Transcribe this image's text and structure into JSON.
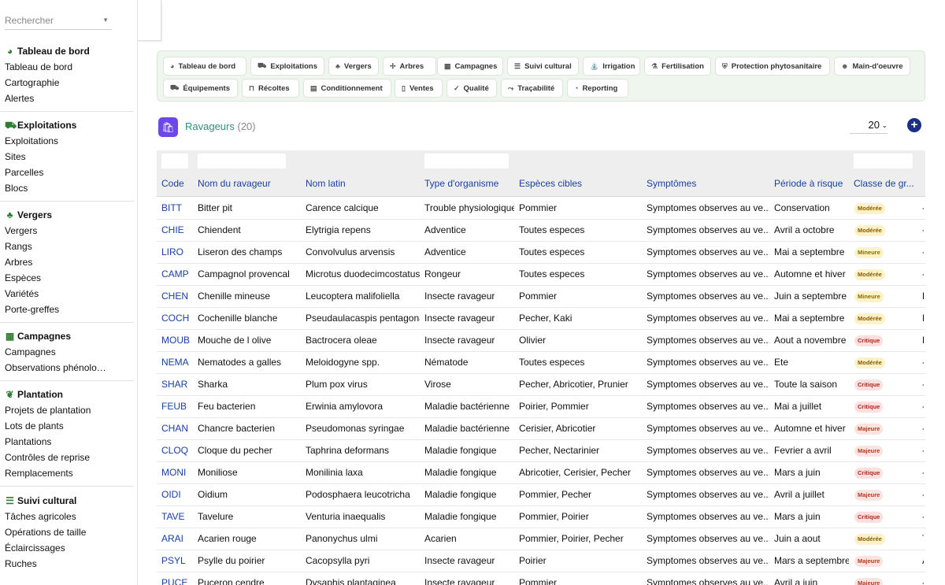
{
  "search": {
    "placeholder": "Rechercher"
  },
  "sidebar": {
    "groups": [
      {
        "title": "Tableau de bord",
        "icon": "dashboard-icon",
        "items": [
          "Tableau de bord",
          "Cartographie",
          "Alertes"
        ]
      },
      {
        "title": "Exploitations",
        "icon": "tractor-icon",
        "items": [
          "Exploitations",
          "Sites",
          "Parcelles",
          "Blocs"
        ]
      },
      {
        "title": "Vergers",
        "icon": "tree-icon",
        "items": [
          "Vergers",
          "Rangs",
          "Arbres",
          "Espèces",
          "Variétés",
          "Porte-greffes"
        ]
      },
      {
        "title": "Campagnes",
        "icon": "calendar-icon",
        "items": [
          "Campagnes",
          "Observations phénologiq..."
        ]
      },
      {
        "title": "Plantation",
        "icon": "seedling-icon",
        "items": [
          "Projets de plantation",
          "Lots de plants",
          "Plantations",
          "Contrôles de reprise",
          "Remplacements"
        ]
      },
      {
        "title": "Suivi cultural",
        "icon": "list-check-icon",
        "items": [
          "Tâches agricoles",
          "Opérations de taille",
          "Éclaircissages",
          "Ruches"
        ]
      }
    ]
  },
  "modules": [
    {
      "label": "Tableau de bord",
      "icon": "dashboard-icon"
    },
    {
      "label": "Exploitations",
      "icon": "tractor-icon"
    },
    {
      "label": "Vergers",
      "icon": "tree-icon"
    },
    {
      "label": "Arbres",
      "icon": "branch-icon"
    },
    {
      "label": "Campagnes",
      "icon": "calendar-icon"
    },
    {
      "label": "Suivi cultural",
      "icon": "list-check-icon"
    },
    {
      "label": "Irrigation",
      "icon": "faucet-icon"
    },
    {
      "label": "Fertilisation",
      "icon": "flask-icon"
    },
    {
      "label": "Protection phytosanitaire",
      "icon": "shield-icon"
    },
    {
      "label": "Main-d'oeuvre",
      "icon": "people-icon"
    },
    {
      "label": "Équipements",
      "icon": "tractor-icon"
    },
    {
      "label": "Récoltes",
      "icon": "basket-icon"
    },
    {
      "label": "Conditionnement",
      "icon": "boxes-icon"
    },
    {
      "label": "Ventes",
      "icon": "invoice-icon"
    },
    {
      "label": "Qualité",
      "icon": "check-icon"
    },
    {
      "label": "Traçabilité",
      "icon": "route-icon"
    },
    {
      "label": "Reporting",
      "icon": "chart-pie-icon"
    }
  ],
  "entity": {
    "title": "Ravageurs",
    "count": "(20)",
    "icon": "bag-icon"
  },
  "page_size": "20",
  "colors": {
    "accent": "#2f8f77",
    "link": "#1a3fa0",
    "entity_icon": "#6d48e8",
    "add_button": "#1a2e8a"
  },
  "table": {
    "columns": [
      "Code",
      "Nom du ravageur",
      "Nom latin",
      "Type d'organisme",
      "Espèces cibles",
      "Symptômes",
      "Période à risque",
      "Classe de gr...",
      "A"
    ],
    "rows": [
      {
        "code": "BITT",
        "nom": "Bitter pit",
        "latin": "Carence calcique",
        "type": "Trouble physiologique",
        "especes": "Pommier",
        "symptomes": "Symptomes observes au ve...",
        "periode": "Conservation",
        "classe": "Modérée",
        "last": "-"
      },
      {
        "code": "CHIE",
        "nom": "Chiendent",
        "latin": "Elytrigia repens",
        "type": "Adventice",
        "especes": "Toutes especes",
        "symptomes": "Symptomes observes au ve...",
        "periode": "Avril a octobre",
        "classe": "Modérée",
        "last": "-"
      },
      {
        "code": "LIRO",
        "nom": "Liseron des champs",
        "latin": "Convolvulus arvensis",
        "type": "Adventice",
        "especes": "Toutes especes",
        "symptomes": "Symptomes observes au ve...",
        "periode": "Mai a septembre",
        "classe": "Mineure",
        "last": "-"
      },
      {
        "code": "CAMP",
        "nom": "Campagnol provencal",
        "latin": "Microtus duodecimcostatus",
        "type": "Rongeur",
        "especes": "Toutes especes",
        "symptomes": "Symptomes observes au ve...",
        "periode": "Automne et hiver",
        "classe": "Modérée",
        "last": "-"
      },
      {
        "code": "CHEN",
        "nom": "Chenille mineuse",
        "latin": "Leucoptera malifoliella",
        "type": "Insecte ravageur",
        "especes": "Pommier",
        "symptomes": "Symptomes observes au ve...",
        "periode": "Juin a septembre",
        "classe": "Mineure",
        "last": "F"
      },
      {
        "code": "COCH",
        "nom": "Cochenille blanche",
        "latin": "Pseudaulacaspis pentagona",
        "type": "Insecte ravageur",
        "especes": "Pecher, Kaki",
        "symptomes": "Symptomes observes au ve...",
        "periode": "Mai a septembre",
        "classe": "Modérée",
        "last": "E"
      },
      {
        "code": "MOUB",
        "nom": "Mouche de l olive",
        "latin": "Bactrocera oleae",
        "type": "Insecte ravageur",
        "especes": "Olivier",
        "symptomes": "Symptomes observes au ve...",
        "periode": "Aout a novembre",
        "classe": "Critique",
        "last": "F"
      },
      {
        "code": "NEMA",
        "nom": "Nematodes a galles",
        "latin": "Meloidogyne spp.",
        "type": "Nématode",
        "especes": "Toutes especes",
        "symptomes": "Symptomes observes au ve...",
        "periode": "Ete",
        "classe": "Modérée",
        "last": "-"
      },
      {
        "code": "SHAR",
        "nom": "Sharka",
        "latin": "Plum pox virus",
        "type": "Virose",
        "especes": "Pecher, Abricotier, Prunier",
        "symptomes": "Symptomes observes au ve...",
        "periode": "Toute la saison",
        "classe": "Critique",
        "last": "-"
      },
      {
        "code": "FEUB",
        "nom": "Feu bacterien",
        "latin": "Erwinia amylovora",
        "type": "Maladie bactérienne",
        "especes": "Poirier, Pommier",
        "symptomes": "Symptomes observes au ve...",
        "periode": "Mai a juillet",
        "classe": "Critique",
        "last": "-"
      },
      {
        "code": "CHAN",
        "nom": "Chancre bacterien",
        "latin": "Pseudomonas syringae",
        "type": "Maladie bactérienne",
        "especes": "Cerisier, Abricotier",
        "symptomes": "Symptomes observes au ve...",
        "periode": "Automne et hiver",
        "classe": "Majeure",
        "last": "-"
      },
      {
        "code": "CLOQ",
        "nom": "Cloque du pecher",
        "latin": "Taphrina deformans",
        "type": "Maladie fongique",
        "especes": "Pecher, Nectarinier",
        "symptomes": "Symptomes observes au ve...",
        "periode": "Fevrier a avril",
        "classe": "Majeure",
        "last": "-"
      },
      {
        "code": "MONI",
        "nom": "Moniliose",
        "latin": "Monilinia laxa",
        "type": "Maladie fongique",
        "especes": "Abricotier, Cerisier, Pecher",
        "symptomes": "Symptomes observes au ve...",
        "periode": "Mars a juin",
        "classe": "Critique",
        "last": "-"
      },
      {
        "code": "OIDI",
        "nom": "Oidium",
        "latin": "Podosphaera leucotricha",
        "type": "Maladie fongique",
        "especes": "Pommier, Pecher",
        "symptomes": "Symptomes observes au ve...",
        "periode": "Avril a juillet",
        "classe": "Majeure",
        "last": "-"
      },
      {
        "code": "TAVE",
        "nom": "Tavelure",
        "latin": "Venturia inaequalis",
        "type": "Maladie fongique",
        "especes": "Pommier, Poirier",
        "symptomes": "Symptomes observes au ve...",
        "periode": "Mars a juin",
        "classe": "Critique",
        "last": "-"
      },
      {
        "code": "ARAI",
        "nom": "Acarien rouge",
        "latin": "Panonychus ulmi",
        "type": "Acarien",
        "especes": "Pommier, Poirier, Pecher",
        "symptomes": "Symptomes observes au ve...",
        "periode": "Juin a aout",
        "classe": "Modérée",
        "last": "T"
      },
      {
        "code": "PSYL",
        "nom": "Psylle du poirier",
        "latin": "Cacopsylla pyri",
        "type": "Insecte ravageur",
        "especes": "Poirier",
        "symptomes": "Symptomes observes au ve...",
        "periode": "Mars a septembre",
        "classe": "Majeure",
        "last": "A"
      },
      {
        "code": "PUCE",
        "nom": "Puceron cendre",
        "latin": "Dysaphis plantaginea",
        "type": "Insecte ravageur",
        "especes": "Pommier",
        "symptomes": "Symptomes observes au ve...",
        "periode": "Avril a juin",
        "classe": "Majeure",
        "last": "-"
      }
    ]
  }
}
